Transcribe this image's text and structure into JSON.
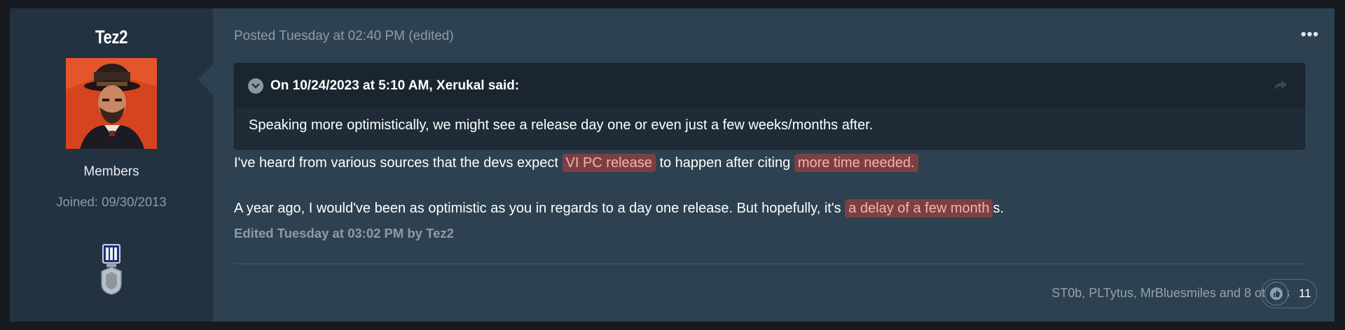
{
  "author": {
    "name": "Tez2",
    "role": "Members",
    "joined": "Joined: 09/30/2013"
  },
  "post": {
    "meta": "Posted Tuesday at 02:40 PM (edited)",
    "menu_label": "•••",
    "quote": {
      "cite": "On 10/24/2023 at 5:10 AM, Xerukal said:",
      "body": "Speaking more optimistically, we might see a release day one or even just a few weeks/months after."
    },
    "paragraph1": {
      "before": "I've heard from various sources that the devs expect ",
      "highlight1": "VI PC release",
      "middle": " to happen after citing ",
      "highlight2": "more time needed."
    },
    "paragraph2": {
      "before": "A year ago, I would've been as optimistic as you in regards to a day one release. But hopefully, it's ",
      "highlight": "a delay of a few month",
      "after": "s."
    },
    "edited": "Edited Tuesday at 03:02 PM by Tez2"
  },
  "reactions": {
    "summary": "ST0b, PLTytus, MrBluesmiles and 8 others",
    "count": "11"
  },
  "colors": {
    "background": "#161a1e",
    "post_bg": "#2d4150",
    "author_bg": "#233240",
    "quote_bg": "#1c2732",
    "highlight_bg": "#8e3a3a",
    "highlight_text": "#f6b0ad"
  },
  "icons": [
    "chevron-down-icon",
    "share-icon",
    "thumbs-up-icon",
    "medal-icon"
  ]
}
